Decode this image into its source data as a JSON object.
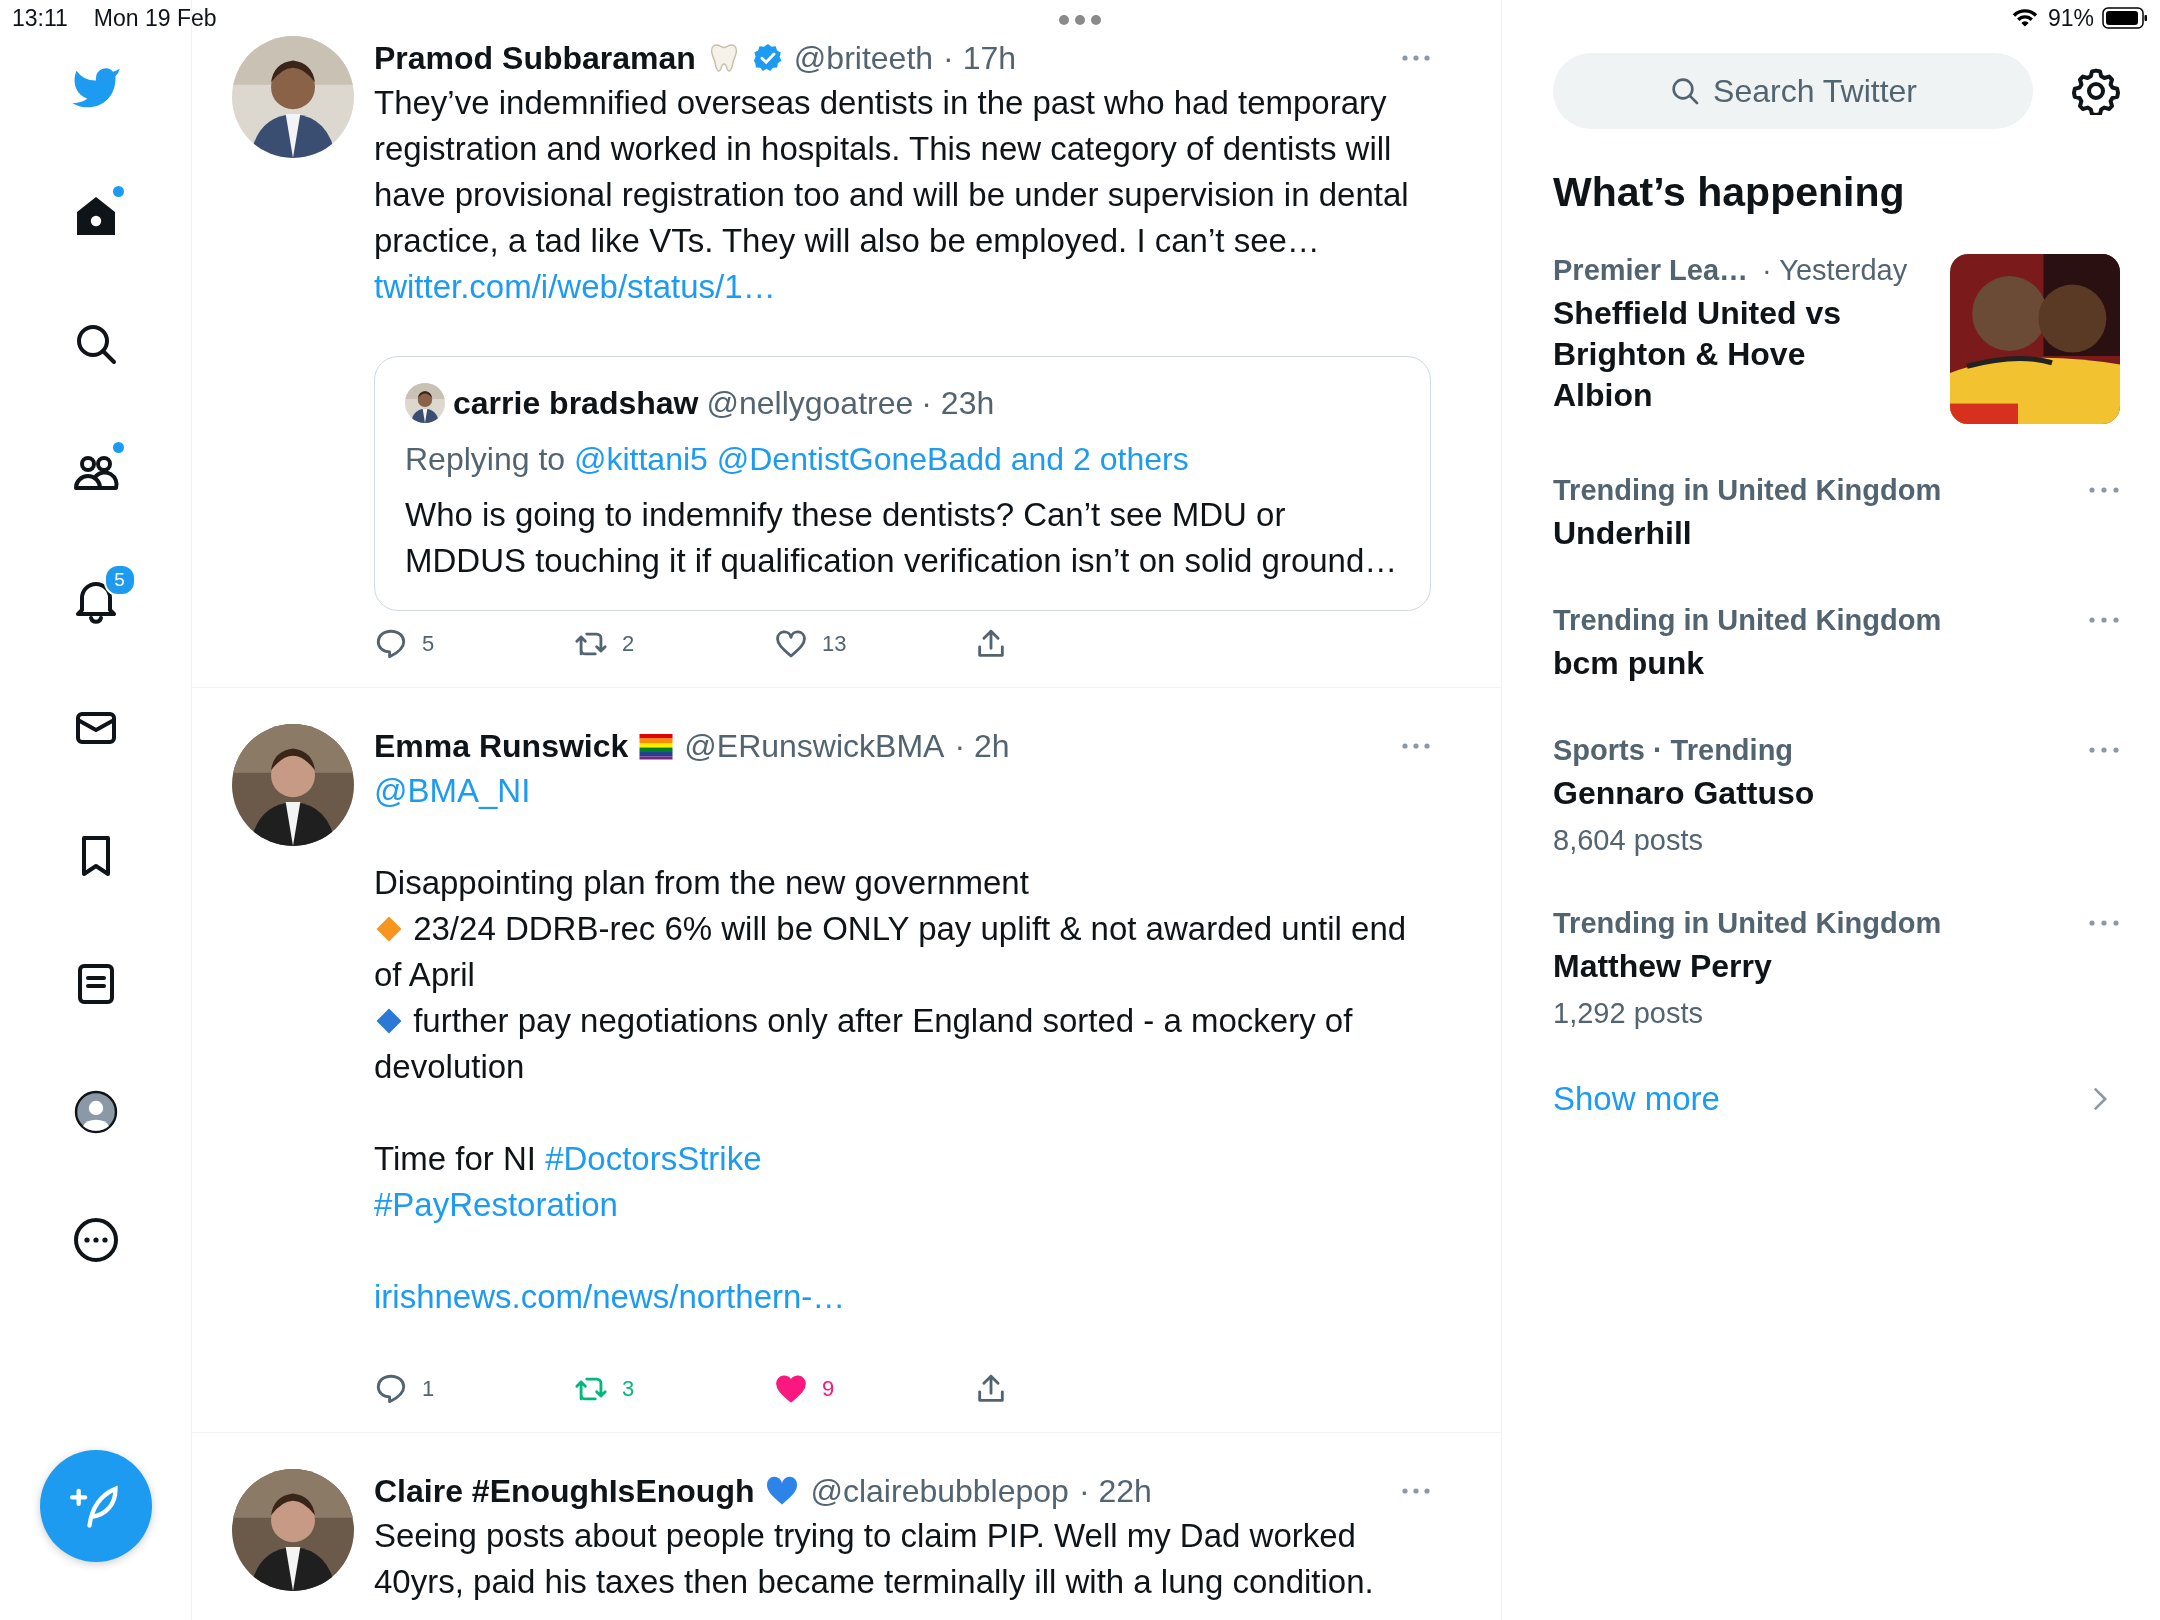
{
  "status_bar": {
    "time": "13:11",
    "date": "Mon 19 Feb",
    "battery": "91%"
  },
  "nav": {
    "items": [
      {
        "kind": "logo",
        "unread": false
      },
      {
        "kind": "home",
        "unread": true
      },
      {
        "kind": "search",
        "unread": false
      },
      {
        "kind": "communities",
        "unread": true
      },
      {
        "kind": "notifications",
        "unread": false,
        "badge": "5"
      },
      {
        "kind": "messages",
        "unread": false
      },
      {
        "kind": "bookmarks",
        "unread": false
      },
      {
        "kind": "lists",
        "unread": false
      },
      {
        "kind": "profile",
        "unread": false
      },
      {
        "kind": "more",
        "unread": false
      }
    ]
  },
  "tweets": [
    {
      "name": "Pramod Subbaraman",
      "name_icon": {
        "kind": "tooth"
      },
      "verified": true,
      "handle": "@briteeth",
      "time": "· 17h",
      "blocks": [
        [
          [
            {
              "kind": "text",
              "text": "They’ve indemnified overseas dentists in the past who had temporary registration and worked in hospitals. This new category of dentists will have provisional registration too and will be under supervision in dental practice, a tad like VTs. They will also be employed. I can’t see…"
            }
          ],
          [
            {
              "kind": "link",
              "text": "twitter.com/i/web/status/1…"
            }
          ]
        ]
      ],
      "quote": {
        "name": "carrie bradshaw",
        "handle": "@nellygoatree",
        "time": "· 23h",
        "replying_to": "Replying to",
        "reply_targets": "@kittani5 @DentistGoneBadd and 2 others",
        "text": "Who is going to indemnify these dentists? Can’t see MDU or MDDUS touching it if qualification verification isn’t on solid ground…"
      },
      "actions": [
        {
          "kind": "reply",
          "count": "5",
          "active": false
        },
        {
          "kind": "retweet",
          "count": "2",
          "active": false
        },
        {
          "kind": "like",
          "count": "13",
          "active": false
        },
        {
          "kind": "share",
          "active": false
        }
      ]
    },
    {
      "name": "Emma Runswick",
      "name_icon": {
        "kind": "pride-flag"
      },
      "verified": false,
      "handle": "@ERunswickBMA",
      "time": "· 2h",
      "blocks": [
        [
          [
            {
              "kind": "link",
              "text": "@BMA_NI"
            }
          ]
        ],
        [
          [
            {
              "kind": "text",
              "text": "Disappointing plan from the new government"
            }
          ],
          [
            {
              "kind": "icon",
              "color": "#f7961e"
            },
            {
              "kind": "text",
              "text": " 23/24 DDRB-rec 6% will be ONLY pay uplift & not awarded until end of April"
            }
          ],
          [
            {
              "kind": "icon",
              "color": "#2b78d6"
            },
            {
              "kind": "text",
              "text": " further pay negotiations only after England sorted - a mockery of devolution"
            }
          ]
        ],
        [
          [
            {
              "kind": "text",
              "text": "Time for NI "
            },
            {
              "kind": "link",
              "text": "#DoctorsStrike"
            }
          ],
          [
            {
              "kind": "link",
              "text": "#PayRestoration"
            }
          ]
        ],
        [
          [
            {
              "kind": "link",
              "text": "irishnews.com/news/northern-…"
            }
          ]
        ]
      ],
      "actions": [
        {
          "kind": "reply",
          "count": "1",
          "active": false
        },
        {
          "kind": "retweet",
          "count": "3",
          "active": true
        },
        {
          "kind": "like",
          "count": "9",
          "active": true
        },
        {
          "kind": "share",
          "active": false
        }
      ]
    },
    {
      "name": "Claire #EnoughIsEnough",
      "name_icon": {
        "kind": "heart"
      },
      "verified": false,
      "handle": "@clairebubblepop",
      "time": "· 22h",
      "blocks": [
        [
          [
            {
              "kind": "text",
              "text": "Seeing posts about people trying to claim PIP. Well my Dad worked 40yrs, paid his taxes then became terminally ill with a lung condition."
            }
          ]
        ]
      ]
    }
  ],
  "sidebar": {
    "search": {
      "placeholder": "Search Twitter"
    },
    "heading": "What’s happening",
    "trends": [
      {
        "category": "Premier Lea…",
        "meta": "· Yesterday",
        "title": "Sheffield United vs Brighton & Hove Albion",
        "kind": "picture"
      },
      {
        "category": "Trending in United Kingdom",
        "title": "Underhill",
        "kind": "menu"
      },
      {
        "category": "Trending in United Kingdom",
        "title": "bcm punk",
        "kind": "menu"
      },
      {
        "category": "Sports · Trending",
        "title": "Gennaro Gattuso",
        "posts": "8,604 posts",
        "kind": "menu"
      },
      {
        "category": "Trending in United Kingdom",
        "title": "Matthew Perry",
        "posts": "1,292 posts",
        "kind": "menu"
      }
    ],
    "show_more": "Show more"
  }
}
